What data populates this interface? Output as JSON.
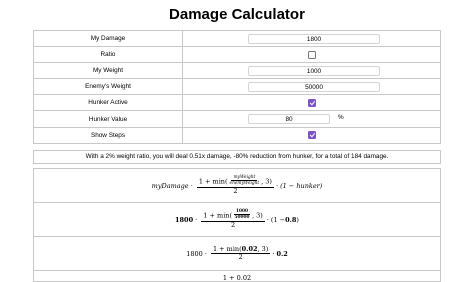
{
  "title": "Damage Calculator",
  "form": {
    "my_damage_label": "My Damage",
    "my_damage_value": "1800",
    "ratio_label": "Ratio",
    "ratio_checked": false,
    "my_weight_label": "My Weight",
    "my_weight_value": "1000",
    "enemy_weight_label": "Enemy's Weight",
    "enemy_weight_value": "50000",
    "hunker_active_label": "Hunker Active",
    "hunker_active_checked": true,
    "hunker_value_label": "Hunker Value",
    "hunker_value": "80",
    "hunker_unit": "%",
    "show_steps_label": "Show Steps",
    "show_steps_checked": true
  },
  "summary": "With a 2% weight ratio, you will deal 0.51x damage, -80% reduction from hunker, for a total of 184 damage.",
  "steps": {
    "s1": {
      "lhs": "myDamage",
      "one_plus_min": "1 + min(",
      "ratio_num": "myWeight",
      "ratio_den": "enemyWeight",
      "comma_three": ", 3)",
      "den": "2",
      "tail": "· (1 − hunker)"
    },
    "s2": {
      "lhs": "1800",
      "one_plus_min": "1 + min(",
      "ratio_num": "1000",
      "ratio_den": "50000",
      "comma_three": ", 3)",
      "den": "2",
      "tail_open": "· (1 − ",
      "hunker": "0.8",
      "tail_close": ")"
    },
    "s3": {
      "lhs": "1800",
      "num_pre": "1 + min(",
      "num_ratio": "0.02",
      "num_post": ", 3)",
      "den": "2",
      "tail_dot": "·",
      "tail": "0.2"
    },
    "s4": {
      "num": "1 + 0.02"
    }
  }
}
